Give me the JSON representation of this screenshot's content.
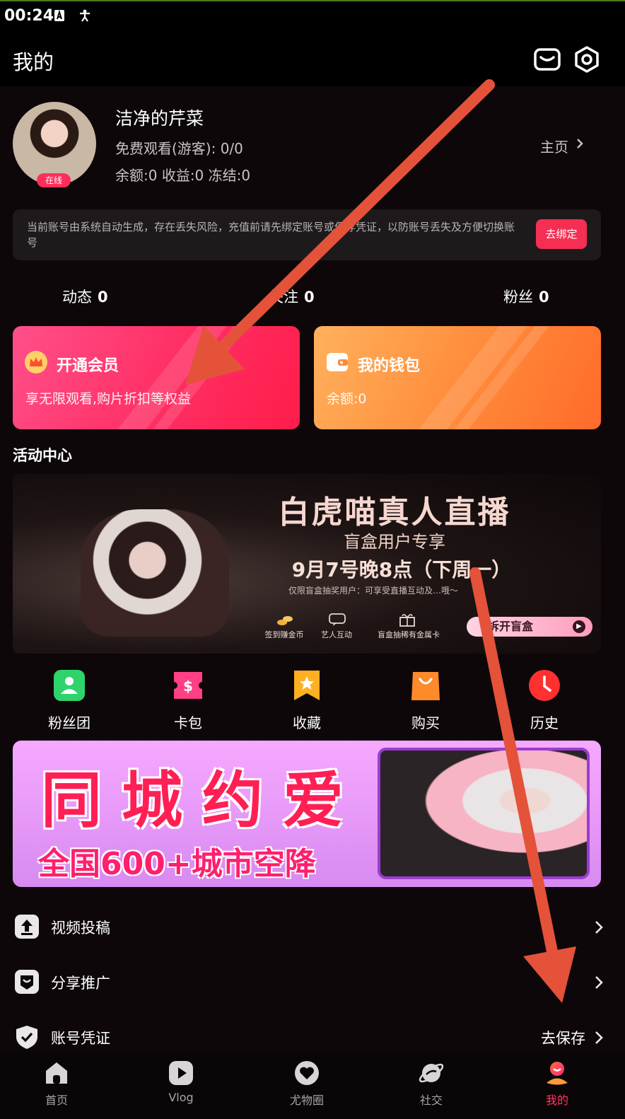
{
  "status_bar": {
    "time": "00:24"
  },
  "header": {
    "title": "我的"
  },
  "profile": {
    "username": "洁净的芹菜",
    "online_badge": "在线",
    "free_watch": "免费观看(游客): 0/0",
    "balance_line": "余额:0 收益:0 冻结:0",
    "homepage_link": "主页"
  },
  "notice": {
    "text": "当前账号由系统自动生成，存在丢失风险，充值前请先绑定账号或保存凭证，以防账号丢失及方便切换账号",
    "button": "去绑定"
  },
  "stats": [
    {
      "label": "动态",
      "value": "0"
    },
    {
      "label": "关注",
      "value": "0"
    },
    {
      "label": "粉丝",
      "value": "0"
    }
  ],
  "cards": {
    "vip": {
      "title": "开通会员",
      "desc": "享无限观看,购片折扣等权益",
      "icon": "crown-icon"
    },
    "wallet": {
      "title": "我的钱包",
      "desc": "余额:0",
      "icon": "wallet-icon"
    }
  },
  "activity": {
    "title": "活动中心",
    "live_banner": {
      "title": "白虎喵真人直播",
      "subtitle": "盲盒用户专享",
      "date": "9月7号晚8点（下周一）",
      "note": "仅限盲盒抽奖用户：可享受直播互动及…哦～",
      "features": [
        "签到赚金币",
        "艺人互动",
        "盲盒抽稀有金属卡"
      ],
      "button": "拆开盲盒"
    }
  },
  "quick_actions": [
    {
      "label": "粉丝团",
      "icon": "fan-club-icon",
      "color": "#2fd36b"
    },
    {
      "label": "卡包",
      "icon": "card-pack-icon",
      "color": "#ff3f86"
    },
    {
      "label": "收藏",
      "icon": "favorite-icon",
      "color": "#ffb020"
    },
    {
      "label": "购买",
      "icon": "shopping-bag-icon",
      "color": "#ff8a2a"
    },
    {
      "label": "历史",
      "icon": "history-clock-icon",
      "color": "#ff3030"
    }
  ],
  "city_banner": {
    "title": "同城约爱",
    "subtitle": "全国600+城市空降"
  },
  "menu": [
    {
      "label": "视频投稿",
      "value": "",
      "icon": "upload-icon"
    },
    {
      "label": "分享推广",
      "value": "",
      "icon": "share-icon"
    },
    {
      "label": "账号凭证",
      "value": "去保存",
      "icon": "shield-check-icon"
    }
  ],
  "tab_bar": [
    {
      "label": "首页",
      "icon": "home-icon",
      "active": false
    },
    {
      "label": "Vlog",
      "icon": "play-icon",
      "active": false
    },
    {
      "label": "尤物圈",
      "icon": "heart-bubble-icon",
      "active": false
    },
    {
      "label": "社交",
      "icon": "planet-icon",
      "active": false
    },
    {
      "label": "我的",
      "icon": "profile-icon",
      "active": true
    }
  ],
  "colors": {
    "accent": "#ff3a63",
    "background": "#0d0709",
    "annotation_arrow": "#e4523a"
  }
}
